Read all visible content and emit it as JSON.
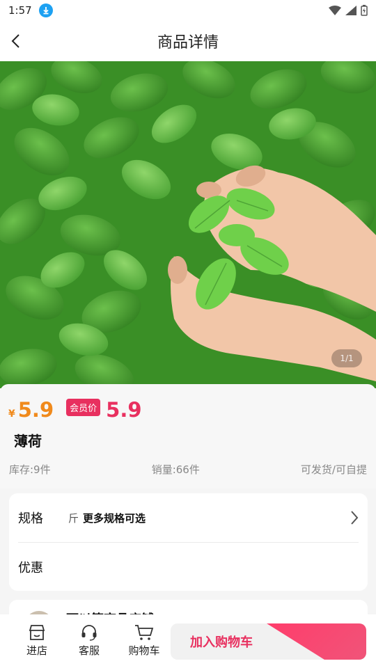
{
  "status_bar": {
    "time": "1:57"
  },
  "nav": {
    "title": "商品详情"
  },
  "gallery": {
    "counter": "1/1"
  },
  "product": {
    "currency": "¥",
    "price": "5.9",
    "member_badge": "会员价",
    "member_price": "5.9",
    "name": "薄荷",
    "stock": "库存:9件",
    "sales": "销量:66件",
    "delivery": "可发货/可自提"
  },
  "spec": {
    "label": "规格",
    "unit": "斤",
    "value": "更多规格可选"
  },
  "discount": {
    "label": "优惠"
  },
  "store": {
    "name": "可以筐商品店铺"
  },
  "bottom_bar": {
    "store_label": "进店",
    "service_label": "客服",
    "cart_label": "购物车",
    "add_to_cart_label": "加入购物车"
  },
  "colors": {
    "price_orange": "#f08a1c",
    "accent_pink": "#e8305f"
  }
}
